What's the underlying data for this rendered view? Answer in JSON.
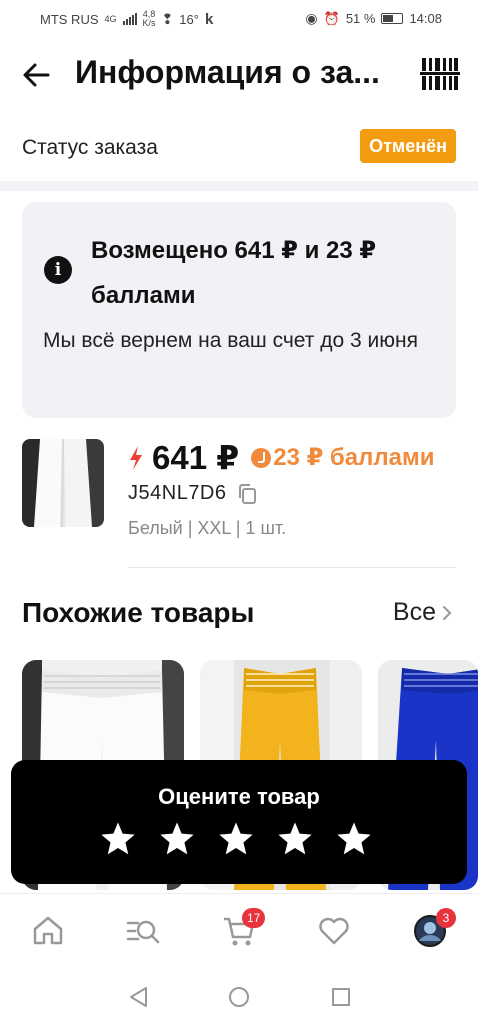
{
  "status_bar": {
    "carrier": "MTS RUS",
    "network": "4G",
    "speed": "4,8",
    "speed_unit": "K/s",
    "temperature": "16°",
    "app_letter": "k",
    "battery": "51 %",
    "time": "14:08"
  },
  "header": {
    "title": "Информация о за...",
    "back_icon": "arrow-left-icon",
    "barcode_icon": "barcode-icon"
  },
  "order_status": {
    "label": "Статус заказа",
    "badge": "Отменён",
    "badge_color": "#f39c12"
  },
  "refund": {
    "title": "Возмещено 641 ₽ и 23 ₽ баллами",
    "text": "Мы всё вернем на ваш счет до 3 июня",
    "icon": "info-icon"
  },
  "product": {
    "price": "641 ₽",
    "points": "23 ₽ баллами",
    "points_color": "#f08a3c",
    "sku": "J54NL7D6",
    "variant": "Белый | XXL | 1 шт."
  },
  "similar": {
    "title": "Похожие товары",
    "all_label": "Все",
    "items": [
      {
        "color": "white",
        "name": "similar-item-white-pants"
      },
      {
        "color": "#f2b31c",
        "name": "similar-item-yellow-pants"
      },
      {
        "color": "#1a34c8",
        "name": "similar-item-blue-pants"
      }
    ]
  },
  "rating": {
    "title": "Оцените товар",
    "stars": 5
  },
  "bottom_nav": {
    "items": [
      "home-icon",
      "catalog-search-icon",
      "cart-icon",
      "favorites-icon",
      "profile-icon"
    ],
    "cart_badge": "17",
    "profile_badge": "3"
  }
}
